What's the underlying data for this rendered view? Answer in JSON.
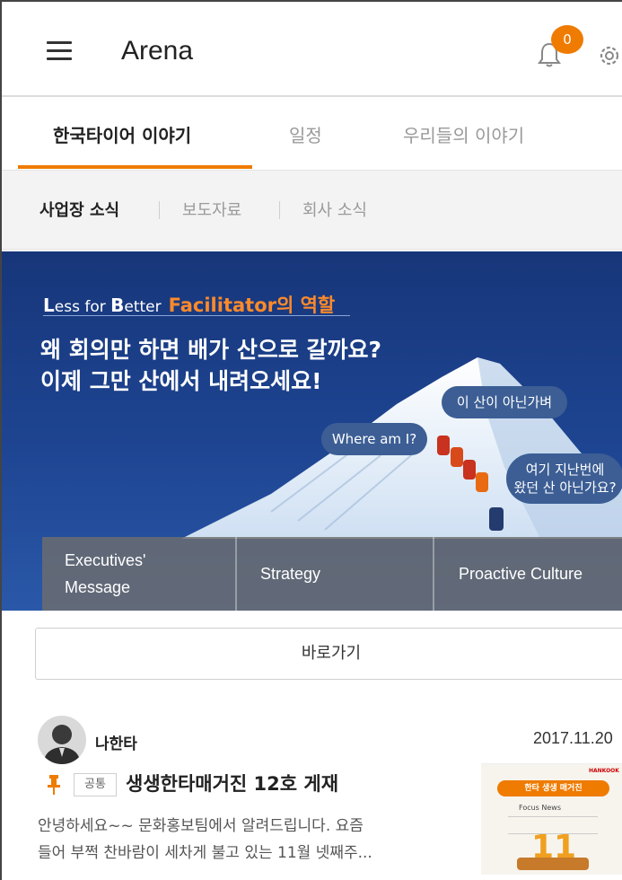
{
  "appbar": {
    "title": "Arena",
    "notification_count": "0",
    "accent": "#ef7b00"
  },
  "tabs": [
    {
      "label": "한국타이어 이야기",
      "active": true
    },
    {
      "label": "일정",
      "active": false
    },
    {
      "label": "우리들의 이야기",
      "active": false
    }
  ],
  "subtabs": [
    {
      "label": "사업장 소식",
      "active": true
    },
    {
      "label": "보도자료",
      "active": false
    },
    {
      "label": "회사 소식",
      "active": false
    }
  ],
  "banner": {
    "brand_l": "L",
    "brand_ess": "ess",
    "brand_for": " for ",
    "brand_b": "B",
    "brand_etter": "etter",
    "brand_highlight": "Facilitator의 역할",
    "headline_line1": "왜 회의만 하면 배가 산으로 갈까요?",
    "headline_line2": "이제 그만 산에서 내려오세요!",
    "bubble_1": "이 산이 아닌가벼",
    "bubble_2": "Where am I?",
    "bubble_3_line1": "여기 지난번에",
    "bubble_3_line2": "왔던 산 아닌가요?",
    "quick_links": {
      "executives_line1": "Executives'",
      "executives_line2": "Message",
      "strategy": "Strategy",
      "culture": "Proactive Culture"
    }
  },
  "shortcut_label": "바로가기",
  "post": {
    "author": "나한타",
    "date": "2017.11.20",
    "tag": "공통",
    "title": "생생한타매거진 12호 게재",
    "excerpt_line1": "안녕하세요~~ 문화홍보팀에서 알려드립니다. 요즘",
    "excerpt_line2": "들어 부쩍 찬바람이 세차게 불고 있는 11월 넷째주..."
  },
  "thumbnail": {
    "logo": "HANKOOK",
    "magazine_title": "한타 생생 매거진",
    "section": "Focus News",
    "issue": "11"
  }
}
